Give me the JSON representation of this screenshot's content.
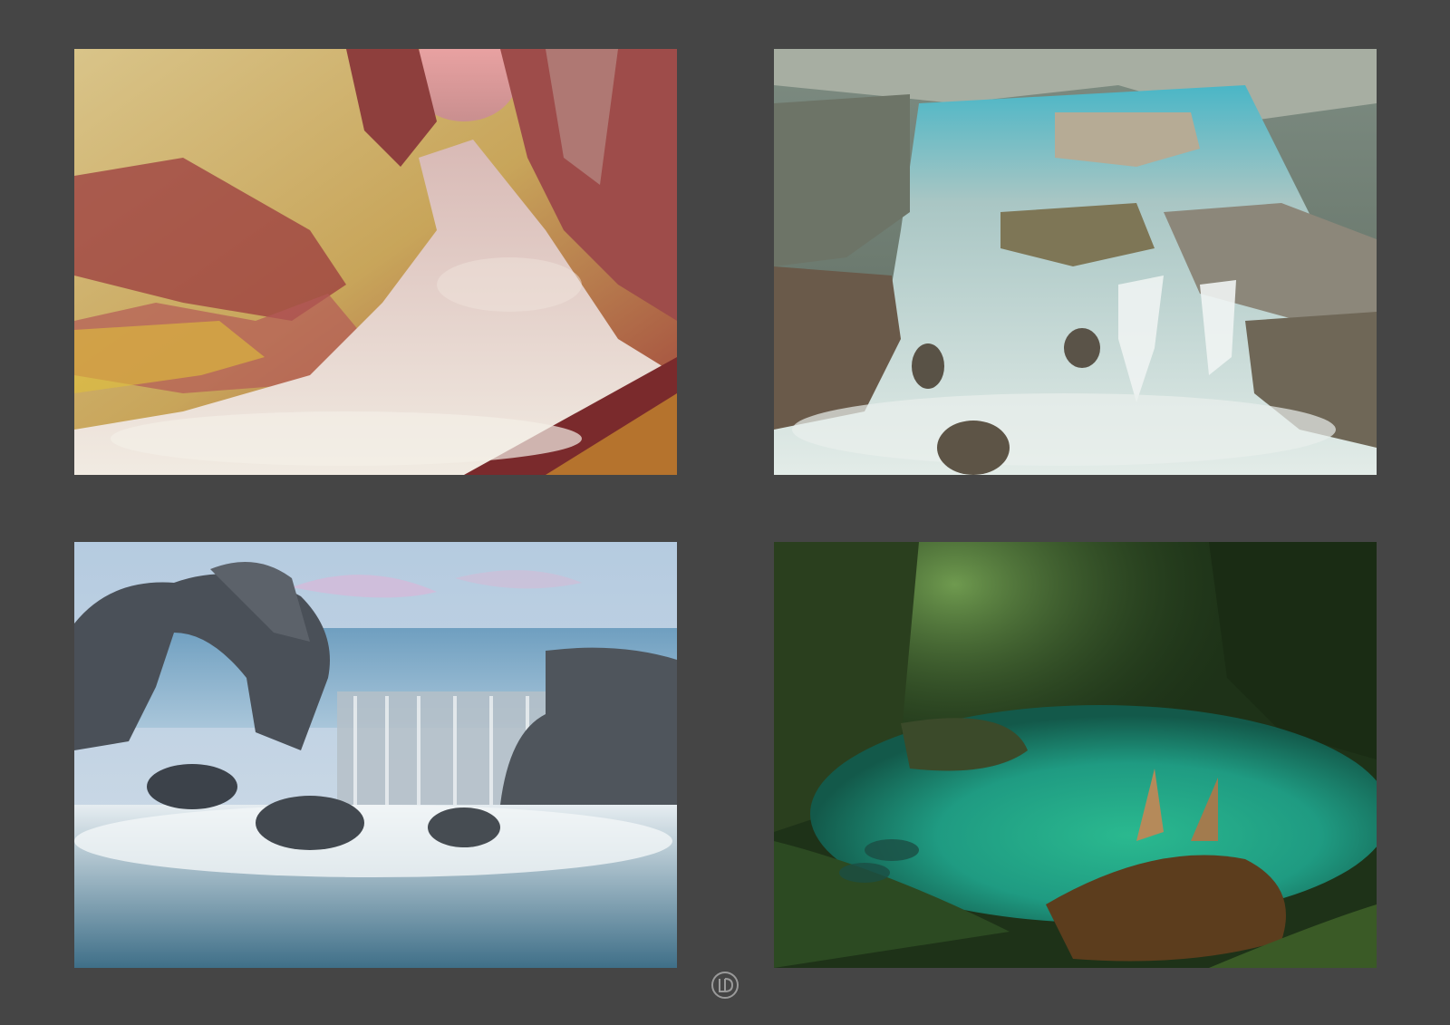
{
  "background_color": "#454545",
  "paintings": [
    {
      "name": "canyon-river",
      "palette": [
        "#c9b36a",
        "#9b3b3f",
        "#e6dccf",
        "#e8a3a4"
      ]
    },
    {
      "name": "rocky-stream",
      "palette": [
        "#8fa39b",
        "#5d6a5e",
        "#d7e2de",
        "#4ab6c6"
      ]
    },
    {
      "name": "sea-arch-falls",
      "palette": [
        "#a9c4da",
        "#4a5058",
        "#e9eef1",
        "#3f6f88"
      ]
    },
    {
      "name": "forest-pool",
      "palette": [
        "#1f3b1a",
        "#2f5c2a",
        "#1f9b82",
        "#6a4a22"
      ]
    }
  ],
  "signature": {
    "icon": "artist-monogram-icon"
  }
}
